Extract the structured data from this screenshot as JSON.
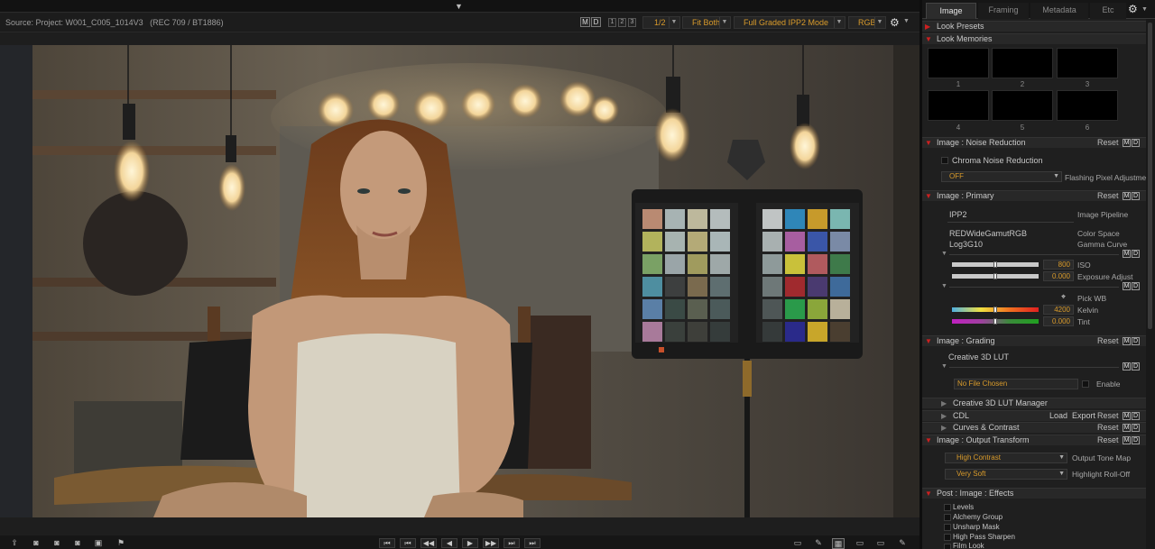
{
  "viewer_bar": {
    "source_label": "Source: Project: W001_C005_1014V3",
    "color_space": "(REC 709 / BT1886)",
    "m_label": "M",
    "d_label": "D",
    "layout_buttons": [
      "1",
      "2",
      "3"
    ],
    "resolution": "1/2",
    "fit_mode": "Fit Both",
    "look_mode": "Full Graded IPP2 Mode",
    "channel": "RGB"
  },
  "tabs": [
    "Image",
    "Framing",
    "Metadata",
    "Etc"
  ],
  "active_tab": "Image",
  "look_presets": {
    "title": "Look Presets"
  },
  "look_memories": {
    "title": "Look Memories",
    "slots": [
      "1",
      "2",
      "3",
      "4",
      "5",
      "6"
    ]
  },
  "noise_reduction": {
    "title": "Image : Noise Reduction",
    "reset": "Reset",
    "chroma_label": "Chroma Noise Reduction",
    "mode_value": "OFF",
    "flashing_label": "Flashing Pixel Adjustment"
  },
  "primary": {
    "title": "Image : Primary",
    "reset": "Reset",
    "pipeline_value": "IPP2",
    "pipeline_label": "Image Pipeline",
    "color_space_value": "REDWideGamutRGB",
    "color_space_label": "Color Space",
    "gamma_value": "Log3G10",
    "gamma_label": "Gamma Curve",
    "iso_value": "800",
    "iso_label": "ISO",
    "iso_level": 0.5,
    "exposure_value": "0.000",
    "exposure_label": "Exposure Adjust",
    "exposure_level": 0.5,
    "pick_wb_label": "Pick WB",
    "kelvin_value": "4200",
    "kelvin_label": "Kelvin",
    "kelvin_level": 0.5,
    "tint_value": "0.000",
    "tint_label": "Tint",
    "tint_level": 0.5
  },
  "grading": {
    "title": "Image : Grading",
    "reset": "Reset",
    "lut_label": "Creative 3D LUT",
    "file_value": "No File Chosen",
    "enable_label": "Enable"
  },
  "collapsed_sections": [
    {
      "title": "Creative 3D LUT Manager"
    },
    {
      "title": "CDL",
      "load": "Load",
      "export": "Export",
      "reset": "Reset"
    },
    {
      "title": "Curves & Contrast",
      "reset": "Reset"
    }
  ],
  "output_transform": {
    "title": "Image : Output Transform",
    "reset": "Reset",
    "tone_map_value": "High Contrast",
    "tone_map_label": "Output Tone Map",
    "rolloff_value": "Very Soft",
    "rolloff_label": "Highlight Roll-Off"
  },
  "effects": {
    "title": "Post : Image : Effects",
    "items": [
      "Levels",
      "Alchemy Group",
      "Unsharp Mask",
      "High Pass Sharpen",
      "Film Look"
    ]
  },
  "transport": {
    "buttons": [
      "⏮",
      "⏮",
      "◀◀",
      "◀",
      "▶",
      "▶▶",
      "⏭",
      "⏭"
    ]
  },
  "colors": {
    "accent_orange": "#d99b2b",
    "section_triangle": "#cc2020",
    "panel_bg": "#1f1f1f"
  }
}
